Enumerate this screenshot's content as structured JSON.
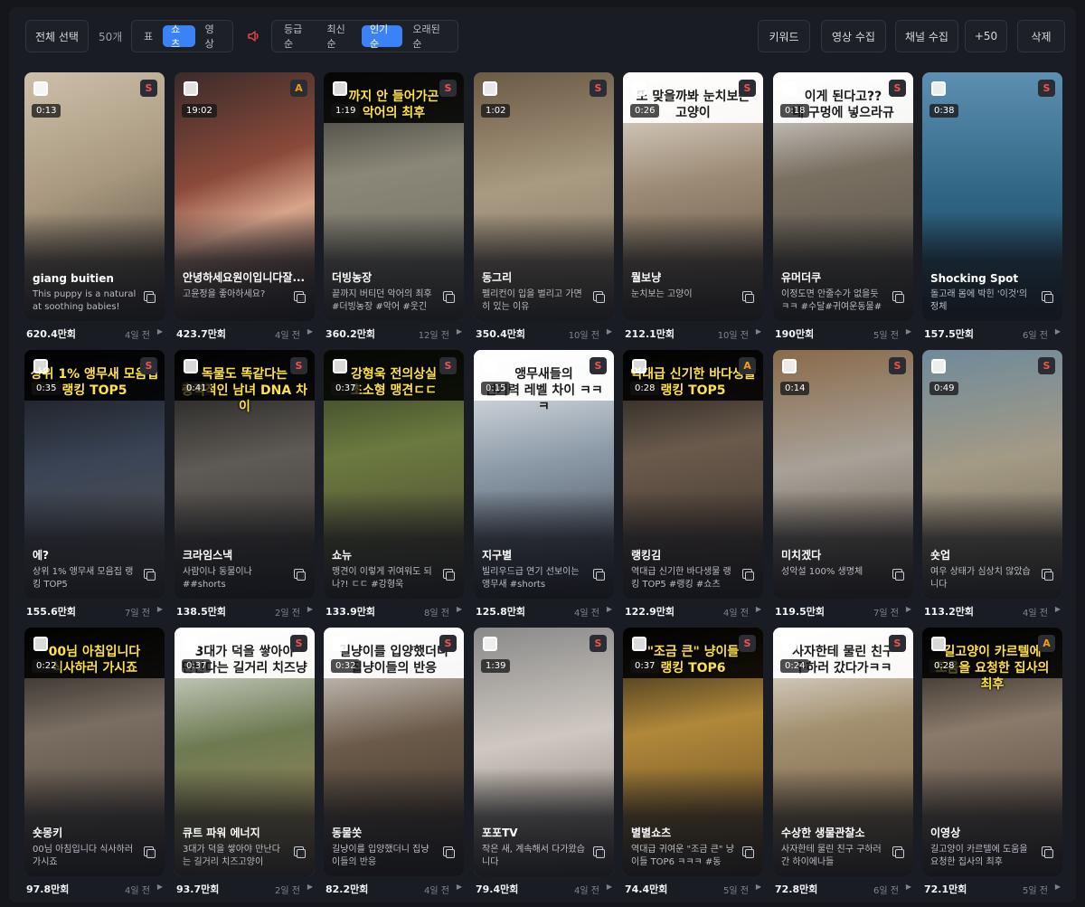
{
  "toolbar": {
    "select_all": "전체 선택",
    "count": "50개",
    "view_modes": [
      "표",
      "쇼츠",
      "영상"
    ],
    "active_view": 1,
    "sort_modes": [
      "등급순",
      "최신순",
      "인기순",
      "오래된순"
    ],
    "active_sort": 2,
    "right_buttons": [
      "키워드",
      "영상 수집",
      "채널 수집",
      "+50",
      "삭제"
    ]
  },
  "colors": {
    "accent": "#3b82f6",
    "grade_s": "#f05252",
    "grade_a": "#f59e0b",
    "speaker": "#ef4444"
  },
  "cards": [
    {
      "grade": "S",
      "duration": "0:13",
      "caption": "",
      "title": "giang buitien",
      "desc": "This puppy is a natural at soothing babies!",
      "views": "620.4만회",
      "age": "4일 전",
      "bg": "linear-gradient(160deg,#cdbfa9 0%,#a8987f 45%,#4a4036 100%)"
    },
    {
      "grade": "A",
      "duration": "19:02",
      "caption": "",
      "title": "안녕하세요원이입니다잘...",
      "desc": "고윤정을 좋아하세요?",
      "views": "423.7만회",
      "age": "4일 전",
      "bg": "linear-gradient(160deg,#3a2b2a 0%,#8a4a3a 40%,#d8a48a 60%,#2a2326 100%)"
    },
    {
      "grade": "S",
      "duration": "1:19",
      "caption": "까지 안 들어가곤\n악어의 최후",
      "captionStyle": "black",
      "title": "더빙농장",
      "desc": "끝까지 버티던 악어의 최후 #더빙농장 #악어 #웃긴동...",
      "views": "360.2만회",
      "age": "12일 전",
      "bg": "linear-gradient(170deg,#2a2a2a 0%,#8b8778 40%,#6e6a5e 100%)"
    },
    {
      "grade": "S",
      "duration": "1:02",
      "caption": "",
      "title": "동그리",
      "desc": "펠리컨이 입을 벌리고 가면 히 있는 이유",
      "views": "350.4만회",
      "age": "10일 전",
      "bg": "linear-gradient(170deg,#6b5a44 0%,#a99a82 45%,#7d6f5d 100%)"
    },
    {
      "grade": "S",
      "duration": "0:26",
      "caption": "또 맞을까봐 눈치보는 고양이",
      "captionStyle": "white",
      "title": "뭘보냥",
      "desc": "눈치보는 고양이",
      "views": "212.1만회",
      "age": "10일 전",
      "bg": "linear-gradient(170deg,#efe9df 0%,#9b8a74 45%,#5b4c3e 100%)"
    },
    {
      "grade": "S",
      "duration": "0:18",
      "caption": "이게 된다고??\n내 구멍에 넣으라규",
      "captionStyle": "white",
      "title": "유머더쿠",
      "desc": "이정도면 안줄수가 없을듯ㅋㅋ #수달#귀여운동물#동...",
      "views": "190만회",
      "age": "5일 전",
      "bg": "linear-gradient(170deg,#f3f3f3 0%,#7a7062 40%,#4e4a40 100%)"
    },
    {
      "grade": "S",
      "duration": "0:38",
      "caption": "",
      "title": "Shocking Spot",
      "desc": "돌고래 몸에 박힌 '이것'의 정체",
      "views": "157.5만회",
      "age": "6일 전",
      "bg": "linear-gradient(180deg,#5d8fb0 0%,#2f6583 50%,#1b3e55 100%)"
    },
    {
      "grade": "S",
      "duration": "0:35",
      "caption": "상위 1% 앵무새 모음집\n랭킹 TOP5",
      "captionStyle": "black",
      "title": "에?",
      "desc": "상위 1% 앵무새 모음집 랭킹 TOP5",
      "views": "155.6만회",
      "age": "7일 전",
      "bg": "linear-gradient(170deg,#111 0%,#3a4456 45%,#5a5650 100%)"
    },
    {
      "grade": "S",
      "duration": "0:41",
      "caption": "독물도 똑같다는\n충격적인 남녀 DNA 차이",
      "captionStyle": "black",
      "title": "크라임스낵",
      "desc": "사람이나 동물이나 ##shorts",
      "views": "138.5만회",
      "age": "2일 전",
      "bg": "linear-gradient(170deg,#111 0%,#5e5a55 45%,#3a3430 100%)"
    },
    {
      "grade": "S",
      "duration": "0:37",
      "caption": "강형욱 전의상실\n초소형 맹견ㄷㄷ",
      "captionStyle": "black",
      "title": "쇼뉴",
      "desc": "맹견이 이렇게 귀여워도 되나?! ㄷㄷ #강형욱",
      "views": "133.9만회",
      "age": "8일 전",
      "bg": "linear-gradient(170deg,#2a3520 0%,#6b7a40 40%,#4a4030 100%)"
    },
    {
      "grade": "S",
      "duration": "0:15",
      "caption": "앵무새들의\n연기력 레벨 차이 ㅋㅋㅋ",
      "captionStyle": "white",
      "title": "지구별",
      "desc": "빌리우드급 연기 선보이는 앵무새 #shorts",
      "views": "125.8만회",
      "age": "4일 전",
      "bg": "linear-gradient(170deg,#f5f5f5 0%,#8c9aa8 45%,#3a3f48 100%)"
    },
    {
      "grade": "A",
      "duration": "0:28",
      "caption": "역대급 신기한 바다생물\n랭킹 TOP5",
      "captionStyle": "black",
      "title": "랭킹김",
      "desc": "역대급 신기한 바다생물 랭킹 TOP5 #랭킹 #쇼츠 #...",
      "views": "122.9만회",
      "age": "4일 전",
      "bg": "linear-gradient(170deg,#111 0%,#6a5a4c 40%,#3b3129 100%)"
    },
    {
      "grade": "S",
      "duration": "0:14",
      "caption": "",
      "title": "미치겠다",
      "desc": "성악설 100% 생명체",
      "views": "119.5만회",
      "age": "7일 전",
      "bg": "linear-gradient(170deg,#8a6a4a 0%,#a7a198 45%,#5a4a3a 100%)"
    },
    {
      "grade": "S",
      "duration": "0:49",
      "caption": "",
      "title": "숏업",
      "desc": "여우 상태가 심상치 않았습니다",
      "views": "113.2만회",
      "age": "4일 전",
      "bg": "linear-gradient(170deg,#6f8a9a 0%,#a39a86 45%,#6e6450 100%)"
    },
    {
      "grade": "",
      "duration": "0:22",
      "caption": "00님 아침입니다\n식사하러 가시죠",
      "captionStyle": "black",
      "title": "숏몽키",
      "desc": "00님 아침입니다 식사하러 가시죠",
      "views": "97.8만회",
      "age": "4일 전",
      "bg": "linear-gradient(170deg,#111 0%,#7a6e62 40%,#4a4036 100%)"
    },
    {
      "grade": "S",
      "duration": "0:37",
      "caption": "3대가 덕을 쌓아야\n만난다는 길거리 치즈냥",
      "captionStyle": "white",
      "title": "큐트 파워 에너지",
      "desc": "3대가 덕을 쌓아야 만난다는 길거리 치즈고양이",
      "views": "93.7만회",
      "age": "2일 전",
      "bg": "linear-gradient(170deg,#f5f5f5 0%,#6d7a52 45%,#a88a5a 100%)"
    },
    {
      "grade": "S",
      "duration": "0:32",
      "caption": "길냥이를 입양했더니\n집냥이들의 반응",
      "captionStyle": "white",
      "title": "동물쏫",
      "desc": "길냥이를 입양했더니 집냥이들의 반응",
      "views": "82.2만회",
      "age": "4일 전",
      "bg": "linear-gradient(170deg,#f0f0f0 0%,#6b5a48 45%,#3a302a 100%)"
    },
    {
      "grade": "S",
      "duration": "1:39",
      "caption": "",
      "title": "포포TV",
      "desc": "작은 새, 계속해서 다가왔습니다",
      "views": "79.4만회",
      "age": "4일 전",
      "bg": "linear-gradient(170deg,#8a8a8a 0%,#cfc8c0 45%,#7a6e66 100%)"
    },
    {
      "grade": "S",
      "duration": "0:37",
      "caption": "\"조금 큰\" 냥이들\n랭킹 TOP6",
      "captionStyle": "black",
      "title": "별별쇼츠",
      "desc": "역대급 귀여운 \"조금 큰\" 냥이들 TOP6 ㅋㅋㅋ #동물...",
      "views": "74.4만회",
      "age": "5일 전",
      "bg": "linear-gradient(170deg,#111 0%,#b0883a 40%,#5e4420 100%)"
    },
    {
      "grade": "S",
      "duration": "0:24",
      "caption": "사자한테 물린 친구\n구하러 갔다가ㅋㅋ",
      "captionStyle": "white",
      "title": "수상한 생물관찰소",
      "desc": "사자한테 물린 친구 구하러 간 하이에나들",
      "views": "72.8만회",
      "age": "6일 전",
      "bg": "linear-gradient(170deg,#f5f5f5 0%,#a39070 40%,#6e5a40 100%)"
    },
    {
      "grade": "A",
      "duration": "0:28",
      "caption": "길고양이 카르텔에\n도움을 요청한 집사의 최후",
      "captionStyle": "black",
      "title": "이영상",
      "desc": "길고양이 카르텔에 도움을 요청한 집사의 최후",
      "views": "72.1만회",
      "age": "5일 전",
      "bg": "linear-gradient(170deg,#111 0%,#8a7a6a 40%,#4a3e34 100%)"
    }
  ]
}
